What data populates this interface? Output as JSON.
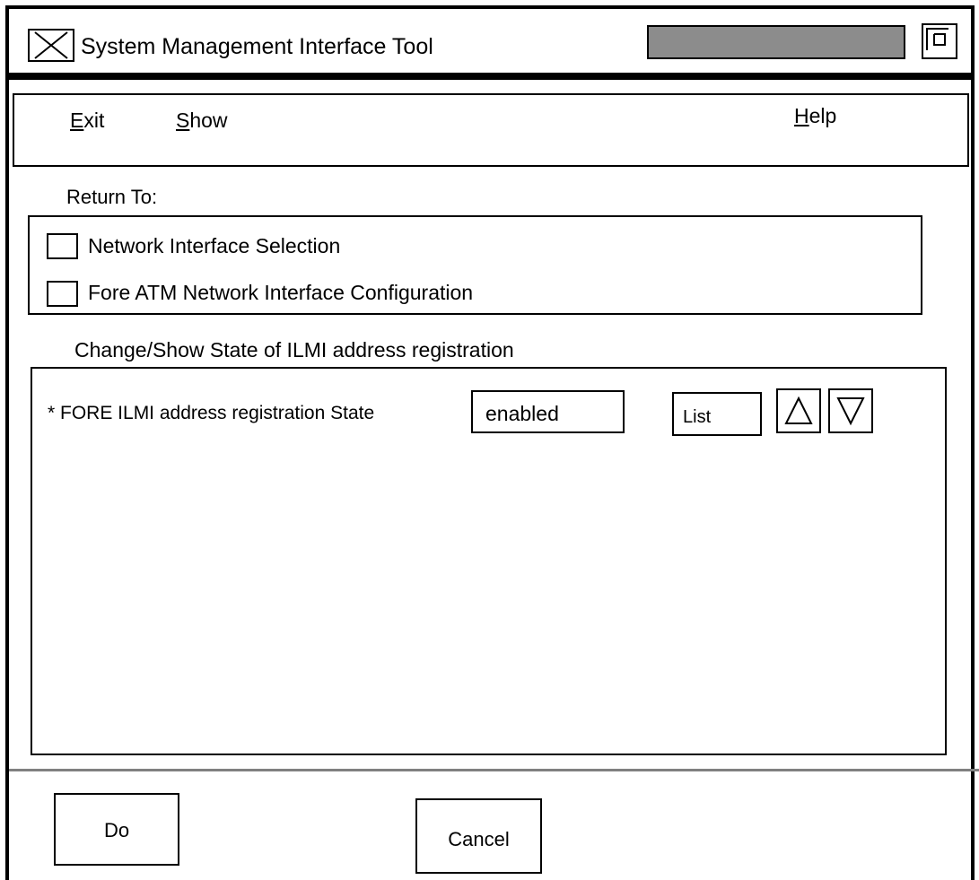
{
  "window": {
    "title": "System Management Interface Tool"
  },
  "menu": {
    "exit": {
      "mnemonic": "E",
      "rest": "xit"
    },
    "show": {
      "mnemonic": "S",
      "rest": "how"
    },
    "help": {
      "mnemonic": "H",
      "rest": "elp"
    }
  },
  "return_to": {
    "label": "Return To:",
    "items": [
      {
        "label": "Network Interface Selection",
        "checked": false
      },
      {
        "label": "Fore ATM Network Interface Configuration",
        "checked": false
      }
    ]
  },
  "form": {
    "heading": "Change/Show State of ILMI address registration",
    "fields": [
      {
        "label": "* FORE ILMI address registration State",
        "value": "enabled",
        "list_label": "List"
      }
    ]
  },
  "buttons": {
    "do": "Do",
    "cancel": "Cancel"
  },
  "icons": {
    "window_menu": "x-close-icon",
    "window_maximize": "maximize-icon",
    "scroll_up": "triangle-up-icon",
    "scroll_down": "triangle-down-icon"
  },
  "colors": {
    "title_slider": "#8c8c8c",
    "divider": "#808080"
  }
}
